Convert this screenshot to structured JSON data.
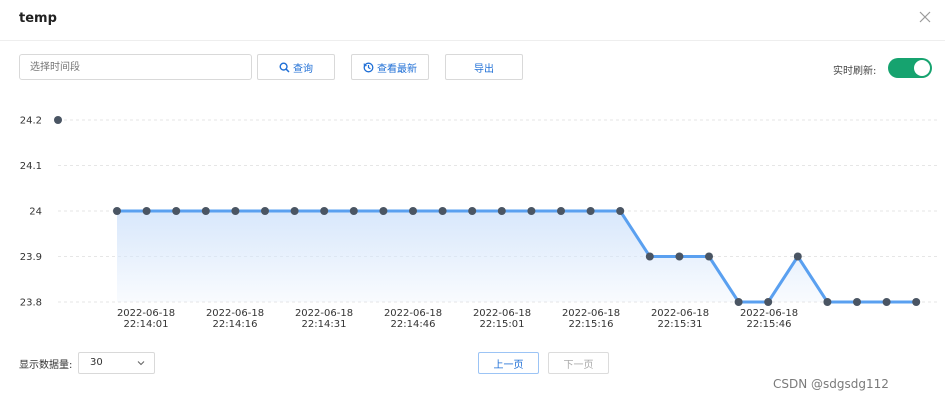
{
  "dialog": {
    "title": "temp",
    "close_icon": "close-icon"
  },
  "toolbar": {
    "time_placeholder": "选择时间段",
    "query_label": "查询",
    "latest_label": "查看最新",
    "export_label": "导出",
    "realtime_label": "实时刷新:",
    "realtime_on": true
  },
  "chart_data": {
    "type": "area",
    "title": "",
    "ylim": [
      23.8,
      24.2
    ],
    "yticks": [
      "24.2",
      "24.1",
      "24",
      "23.9",
      "23.8"
    ],
    "xtick_labels": [
      {
        "date": "2022-06-18",
        "time": "22:14:01"
      },
      {
        "date": "2022-06-18",
        "time": "22:14:16"
      },
      {
        "date": "2022-06-18",
        "time": "22:14:31"
      },
      {
        "date": "2022-06-18",
        "time": "22:14:46"
      },
      {
        "date": "2022-06-18",
        "time": "22:15:01"
      },
      {
        "date": "2022-06-18",
        "time": "22:15:16"
      },
      {
        "date": "2022-06-18",
        "time": "22:15:31"
      },
      {
        "date": "2022-06-18",
        "time": "22:15:46"
      }
    ],
    "values": [
      24.2,
      24,
      24,
      24,
      24,
      24,
      24,
      24,
      24,
      24,
      24,
      24,
      24,
      24,
      24,
      24,
      24,
      24,
      24,
      23.9,
      23.9,
      23.9,
      23.8,
      23.8,
      23.9,
      23.8,
      23.8,
      23.8,
      23.8
    ],
    "grid": true,
    "colors": {
      "line": "#5aa0f0",
      "point": "#4a5563",
      "area": "#d6e6fb"
    }
  },
  "footer": {
    "count_label": "显示数据量:",
    "count_value": "30",
    "prev_label": "上一页",
    "next_label": "下一页"
  },
  "watermark": "CSDN @sdgsdg112"
}
